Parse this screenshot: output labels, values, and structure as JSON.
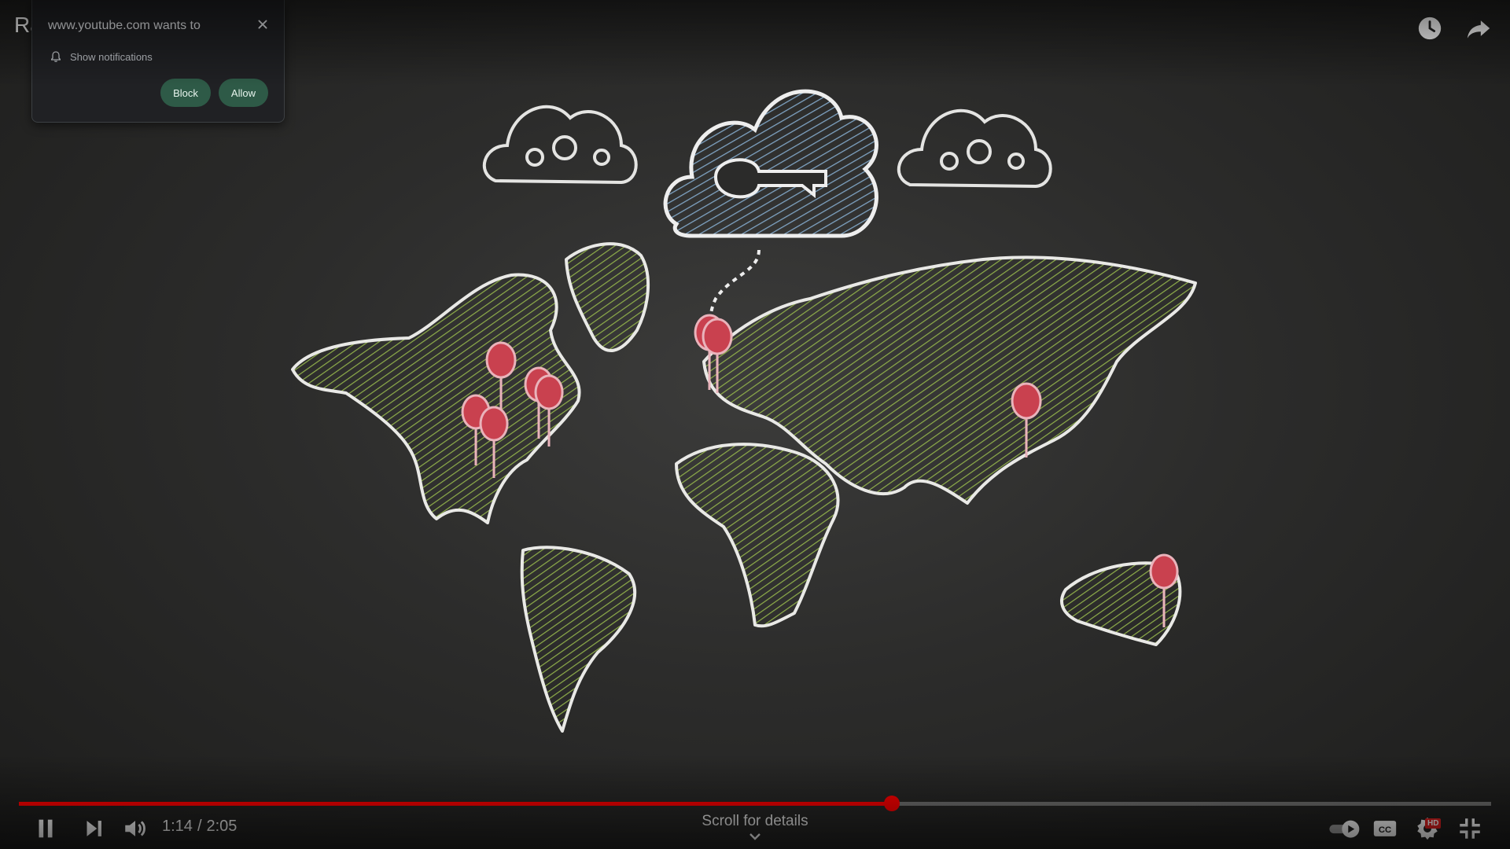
{
  "video": {
    "title": "Ra                         erview",
    "elapsed": "1:14",
    "time_separator": "/",
    "duration": "2:05",
    "progress_fraction": 0.593,
    "scroll_hint": "Scroll for details",
    "hd_badge": "HD",
    "accent_color": "#ff0000"
  },
  "permission_popup": {
    "title": "www.youtube.com wants to",
    "permission": "Show notifications",
    "block_label": "Block",
    "allow_label": "Allow",
    "button_color": "#2e5a47"
  },
  "icons": {
    "top_right": [
      "watch-later-icon",
      "share-icon"
    ],
    "controls_left": [
      "pause-icon",
      "next-icon",
      "volume-icon"
    ],
    "controls_right": [
      "autoplay-toggle-icon",
      "captions-icon",
      "settings-icon",
      "exit-fullscreen-icon"
    ]
  }
}
